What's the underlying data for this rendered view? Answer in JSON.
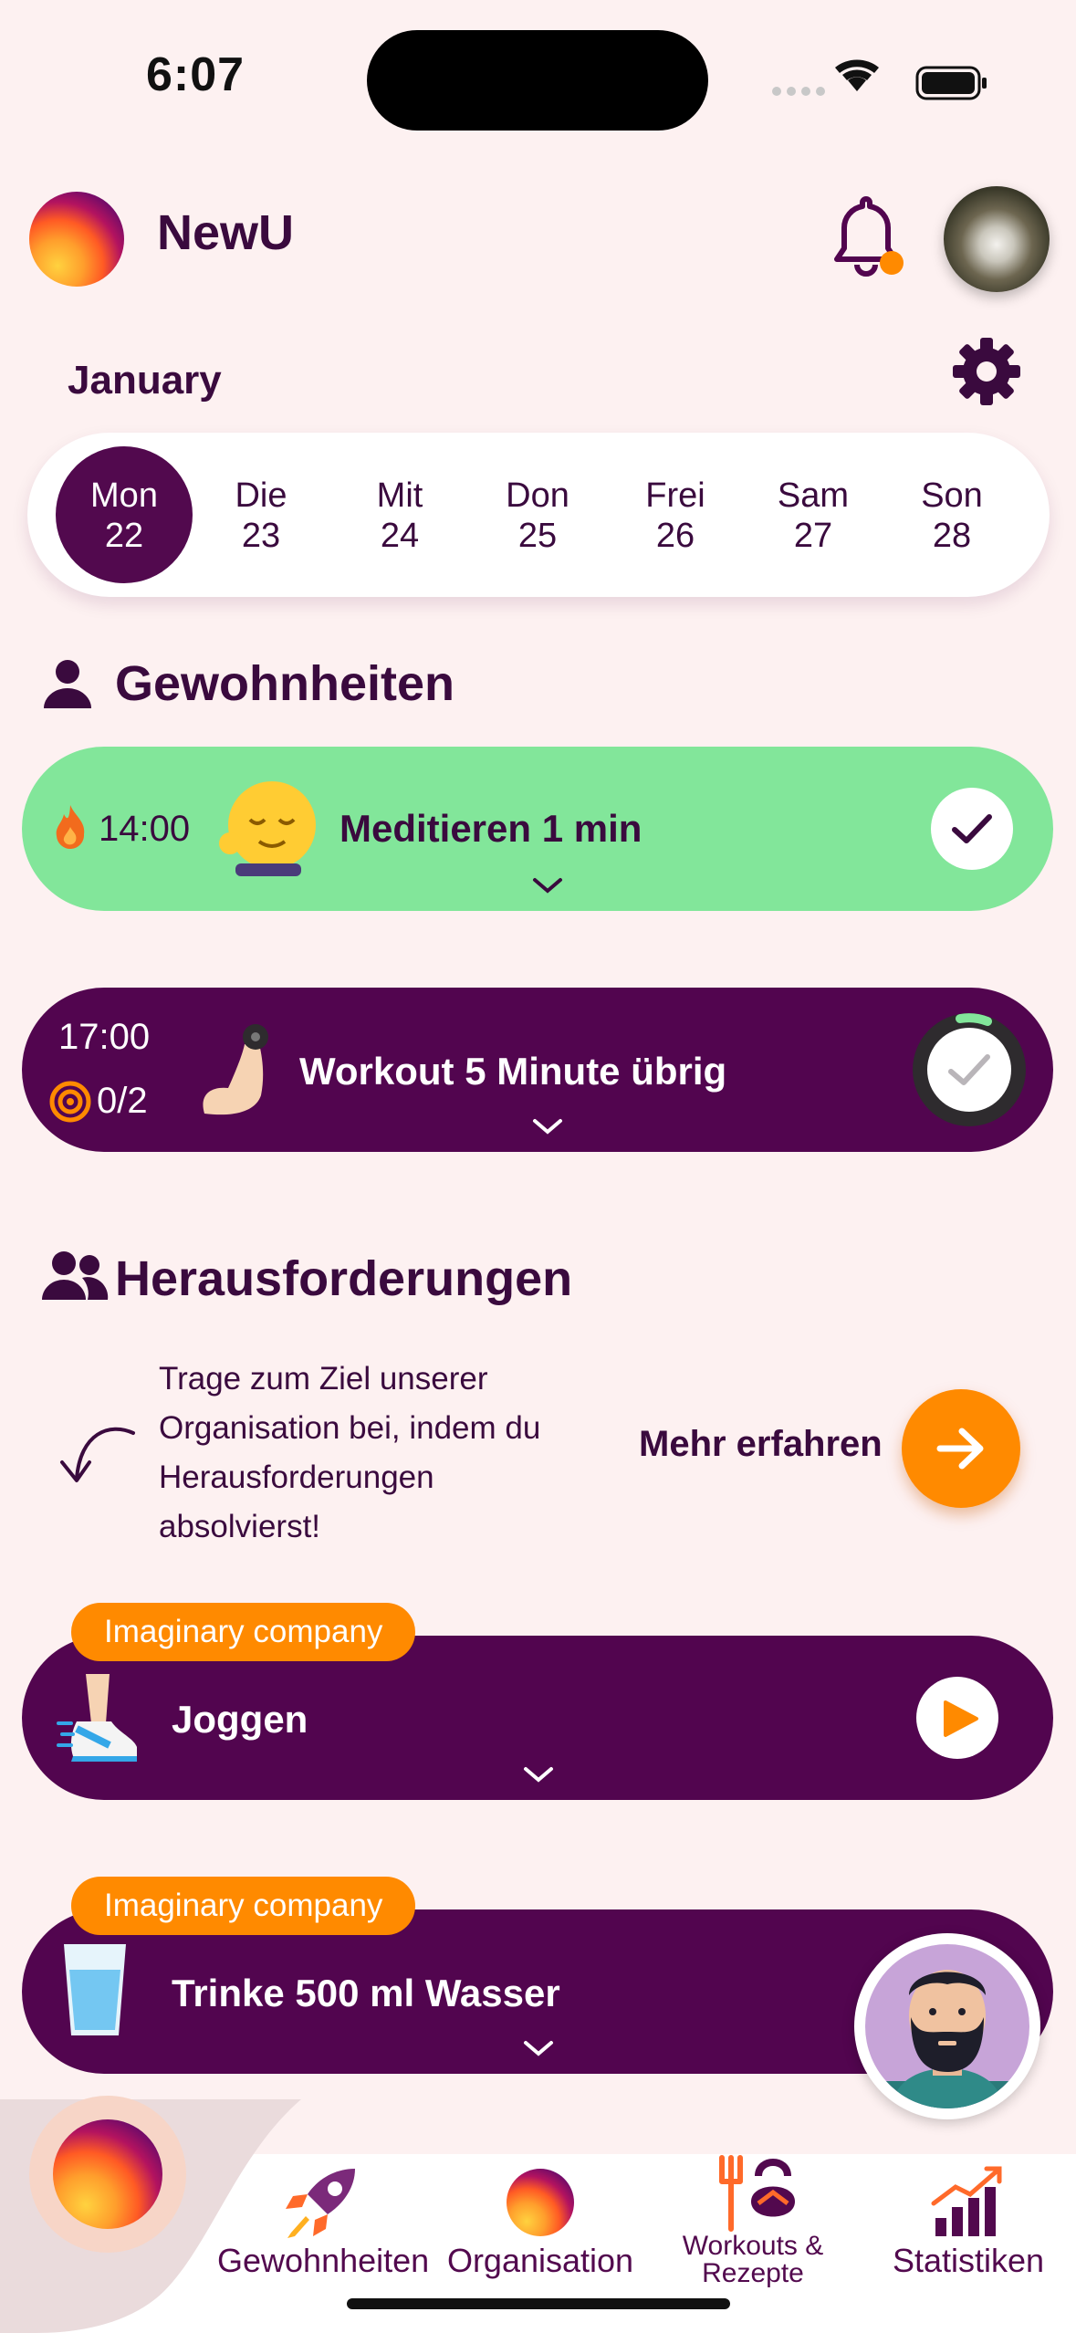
{
  "status_bar": {
    "time": "6:07"
  },
  "header": {
    "app_name": "NewU"
  },
  "calendar": {
    "month": "January",
    "days": [
      {
        "name": "Mon",
        "date": "22",
        "active": true
      },
      {
        "name": "Die",
        "date": "23"
      },
      {
        "name": "Mit",
        "date": "24"
      },
      {
        "name": "Don",
        "date": "25"
      },
      {
        "name": "Frei",
        "date": "26"
      },
      {
        "name": "Sam",
        "date": "27"
      },
      {
        "name": "Son",
        "date": "28"
      }
    ]
  },
  "habits": {
    "title": "Gewohnheiten",
    "items": [
      {
        "time": "14:00",
        "title": "Meditieren 1 min",
        "status": "done"
      },
      {
        "time": "17:00",
        "progress": "0/2",
        "title": "Workout 5 Minute übrig",
        "status": "timer"
      }
    ]
  },
  "challenges": {
    "title": "Herausforderungen",
    "description": [
      "Trage zum Ziel unserer",
      "Organisation bei, indem du",
      "Herausforderungen",
      "absolvierst!"
    ],
    "more_label": "Mehr erfahren",
    "items": [
      {
        "company": "Imaginary company",
        "title": "Joggen"
      },
      {
        "company": "Imaginary company",
        "title": "Trinke 500 ml Wasser"
      }
    ]
  },
  "nav": {
    "items": [
      {
        "label": "Gewohnheiten"
      },
      {
        "label": "Organisation"
      },
      {
        "label_line1": "Workouts &",
        "label_line2": "Rezepte"
      },
      {
        "label": "Statistiken"
      }
    ]
  },
  "colors": {
    "primary": "#52054f",
    "accent": "#ff8a00",
    "green": "#82e69a",
    "background": "#fdf1f1"
  }
}
